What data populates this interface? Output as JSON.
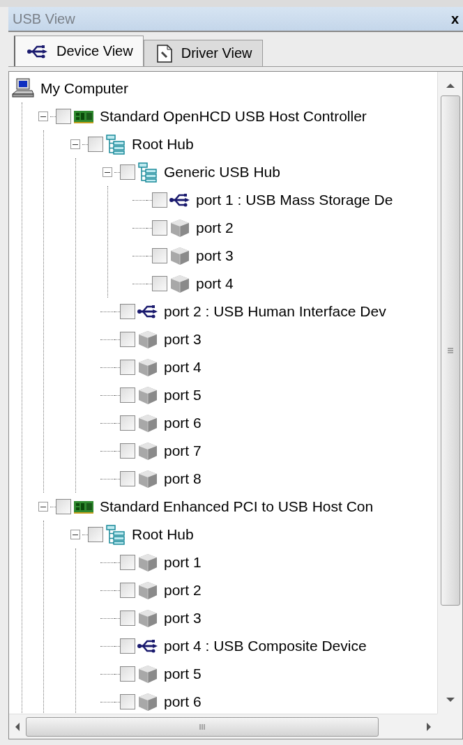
{
  "panel": {
    "title": "USB View",
    "close": "x"
  },
  "tabs": [
    {
      "label": "Device View",
      "selected": true
    },
    {
      "label": "Driver View",
      "selected": false
    }
  ],
  "tree": [
    {
      "label": "My Computer",
      "kind": "computer",
      "children": [
        {
          "label": "Standard OpenHCD USB Host Controller",
          "kind": "controller",
          "checked": false,
          "expanded": true,
          "children": [
            {
              "label": "Root Hub",
              "kind": "hub",
              "checked": false,
              "expanded": true,
              "children": [
                {
                  "label": "Generic USB Hub",
                  "kind": "hub",
                  "checked": false,
                  "expanded": true,
                  "children": [
                    {
                      "label": "port 1 : USB Mass Storage De",
                      "kind": "usb",
                      "checked": false
                    },
                    {
                      "label": "port 2",
                      "kind": "port",
                      "checked": false
                    },
                    {
                      "label": "port 3",
                      "kind": "port",
                      "checked": false
                    },
                    {
                      "label": "port 4",
                      "kind": "port",
                      "checked": false
                    }
                  ]
                },
                {
                  "label": "port 2 : USB Human Interface Dev",
                  "kind": "usb",
                  "checked": false
                },
                {
                  "label": "port 3",
                  "kind": "port",
                  "checked": false
                },
                {
                  "label": "port 4",
                  "kind": "port",
                  "checked": false
                },
                {
                  "label": "port 5",
                  "kind": "port",
                  "checked": false
                },
                {
                  "label": "port 6",
                  "kind": "port",
                  "checked": false
                },
                {
                  "label": "port 7",
                  "kind": "port",
                  "checked": false
                },
                {
                  "label": "port 8",
                  "kind": "port",
                  "checked": false
                }
              ]
            }
          ]
        },
        {
          "label": "Standard Enhanced PCI to USB Host Con",
          "kind": "controller",
          "checked": false,
          "expanded": true,
          "children": [
            {
              "label": "Root Hub",
              "kind": "hub",
              "checked": false,
              "expanded": true,
              "children": [
                {
                  "label": "port 1",
                  "kind": "port",
                  "checked": false
                },
                {
                  "label": "port 2",
                  "kind": "port",
                  "checked": false
                },
                {
                  "label": "port 3",
                  "kind": "port",
                  "checked": false
                },
                {
                  "label": "port 4 : USB Composite Device",
                  "kind": "usb",
                  "checked": false
                },
                {
                  "label": "port 5",
                  "kind": "port",
                  "checked": false
                },
                {
                  "label": "port 6",
                  "kind": "port",
                  "checked": false
                }
              ]
            }
          ]
        }
      ]
    }
  ]
}
